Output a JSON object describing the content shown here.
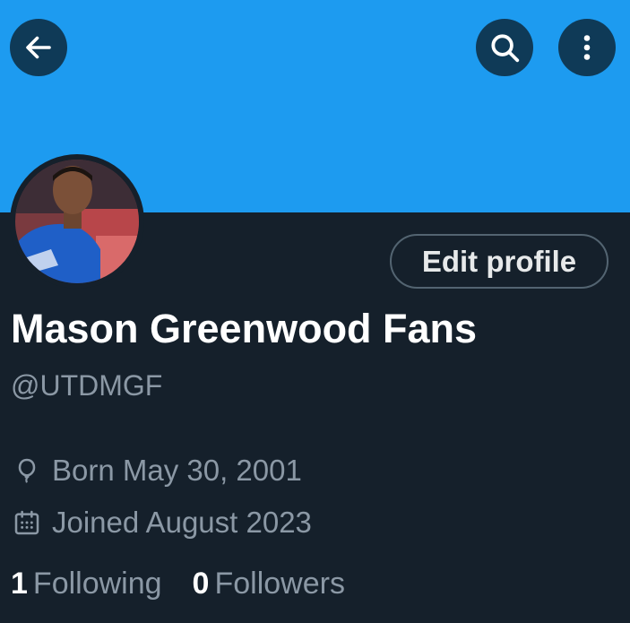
{
  "header": {
    "back_icon": "arrow-left-icon",
    "search_icon": "search-icon",
    "more_icon": "more-vertical-icon",
    "banner_color": "#1d9bf0",
    "button_color": "#0f3a57"
  },
  "profile": {
    "avatar_description": "profile-photo",
    "edit_button_label": "Edit profile",
    "display_name": "Mason Greenwood Fans",
    "handle": "@UTDMGF",
    "born": "Born May 30, 2001",
    "joined": "Joined August 2023",
    "following_count": "1",
    "following_label": "Following",
    "followers_count": "0",
    "followers_label": "Followers"
  },
  "theme": {
    "background": "#15202b",
    "text_primary": "#e7e9ea",
    "text_secondary": "#8b98a5"
  }
}
